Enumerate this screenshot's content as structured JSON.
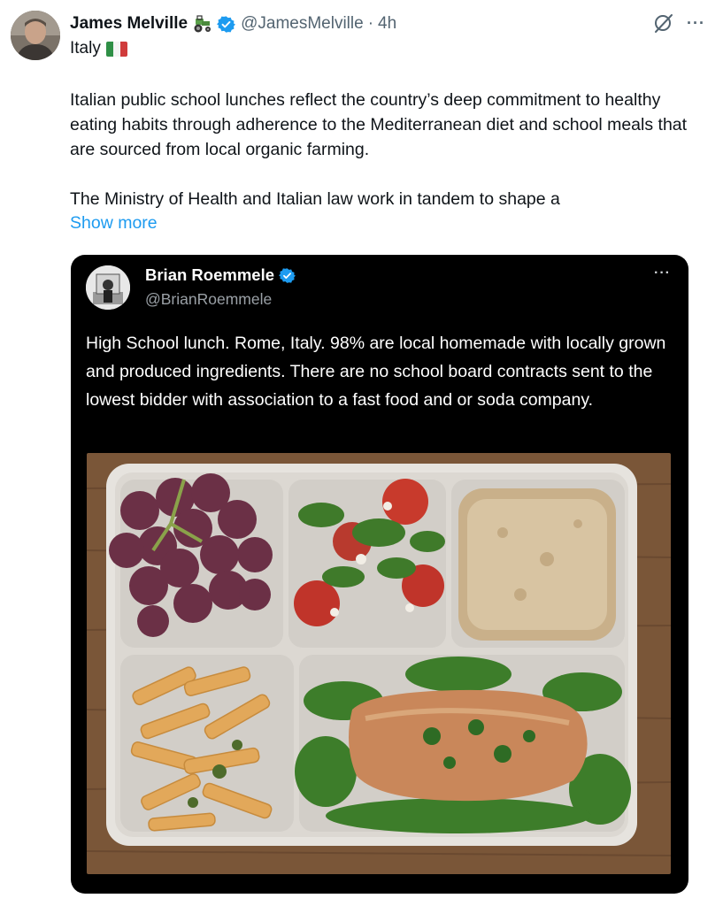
{
  "tweet": {
    "author_name": "James Melville",
    "author_emoji": "tractor-emoji",
    "handle": "@JamesMelville",
    "separator": "·",
    "time": "4h",
    "location_text": "Italy",
    "paragraph1": "Italian public school lunches reflect the country’s deep commitment to healthy eating habits through adherence to the Mediterranean diet and school meals that are sourced from local organic farming.",
    "paragraph2": "The Ministry of Health and Italian law work in tandem to shape a",
    "show_more": "Show more"
  },
  "quoted": {
    "author_name": "Brian Roemmele",
    "handle": "@BrianRoemmele",
    "text": "High School lunch. Rome, Italy. 98% are local homemade with locally grown and produced ingredients. There are no school board contracts sent to the lowest bidder with association to a fast food and or soda company."
  },
  "colors": {
    "link": "#1d9bf0",
    "verified": "#1d9bf0",
    "secondary_text": "#536471",
    "embed_bg": "#000000"
  },
  "icons": [
    "grok-icon",
    "more-icon",
    "verified-badge-icon",
    "italy-flag-icon",
    "tractor-emoji"
  ]
}
